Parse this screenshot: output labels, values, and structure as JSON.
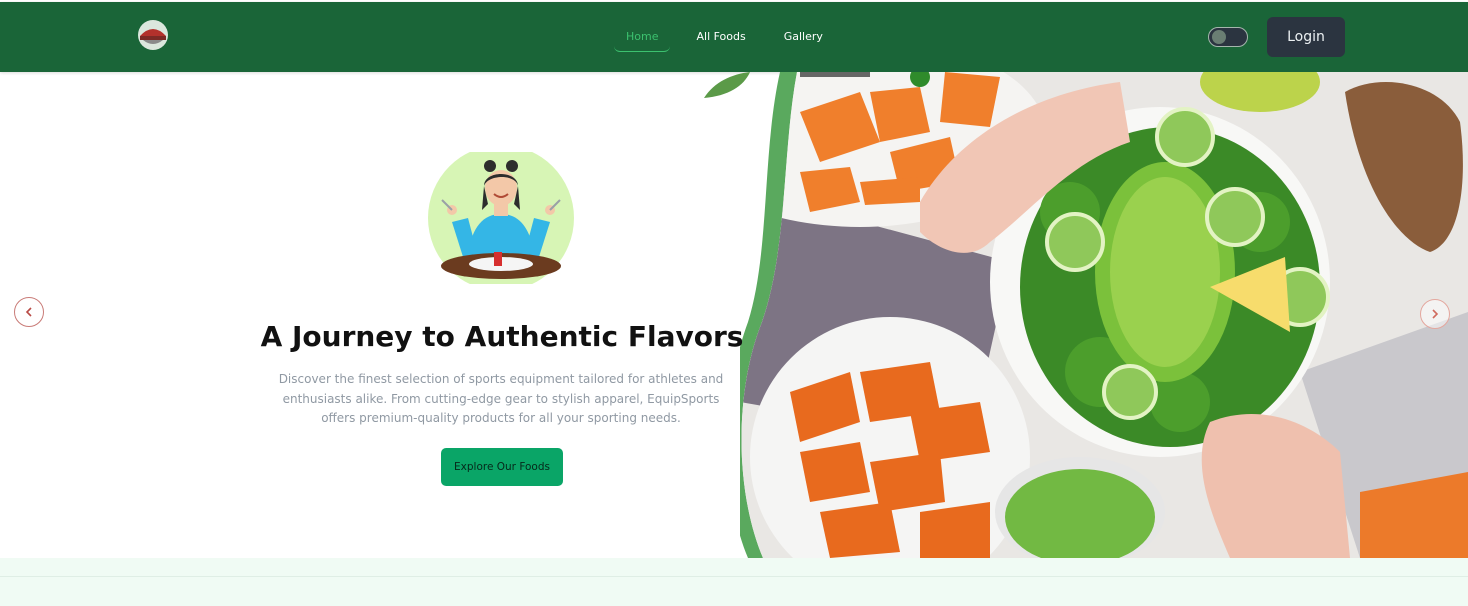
{
  "nav": {
    "links": [
      {
        "label": "Home",
        "active": true
      },
      {
        "label": "All Foods",
        "active": false
      },
      {
        "label": "Gallery",
        "active": false
      }
    ],
    "login_label": "Login",
    "theme_toggle": "off"
  },
  "hero": {
    "title": "A Journey to Authentic Flavors",
    "description": "Discover the finest selection of sports equipment tailored for athletes and enthusiasts alike. From cutting-edge gear to stylish apparel, EquipSports offers premium-quality products for all your sporting needs.",
    "cta_label": "Explore Our Foods",
    "prev_icon": "chevron-left-icon",
    "next_icon": "chevron-right-icon"
  },
  "colors": {
    "navbar_bg": "#1a6538",
    "active_link": "#3cc16f",
    "cta_bg": "#0aa567",
    "login_bg": "#2b3440",
    "leaf_green": "#5aa95e"
  }
}
